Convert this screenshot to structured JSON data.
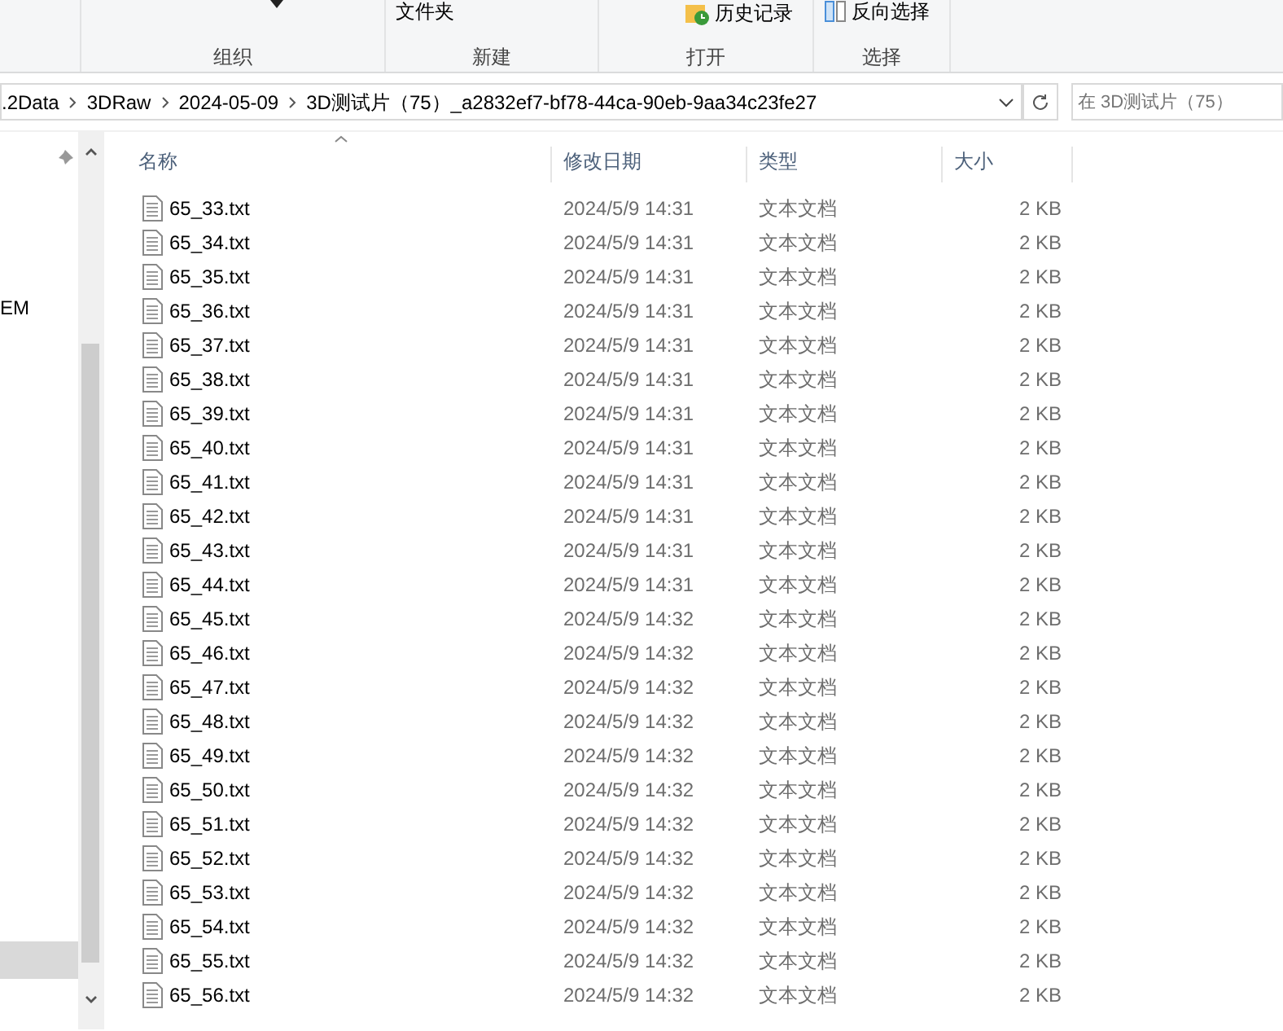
{
  "ribbon": {
    "top_items": [
      {
        "kind": "plain",
        "label": "文件夹"
      },
      {
        "kind": "history",
        "label": "历史记录"
      },
      {
        "kind": "select",
        "label": "反向选择"
      }
    ],
    "groups": [
      "组织",
      "新建",
      "打开",
      "选择"
    ]
  },
  "address_bar": {
    "crumbs": [
      ".2Data",
      "3DRaw",
      "2024-05-09",
      "3D测试片（75）_a2832ef7-bf78-44ca-90eb-9aa34c23fe27"
    ],
    "search_placeholder": "在 3D测试片（75）"
  },
  "nav_pane": {
    "items": [
      {
        "label": "EM",
        "selected": false
      },
      {
        "selected": true
      }
    ]
  },
  "file_list": {
    "columns": [
      "名称",
      "修改日期",
      "类型",
      "大小"
    ],
    "rows": [
      {
        "name": "65_33.txt",
        "date": "2024/5/9 14:31",
        "type": "文本文档",
        "size": "2 KB"
      },
      {
        "name": "65_34.txt",
        "date": "2024/5/9 14:31",
        "type": "文本文档",
        "size": "2 KB"
      },
      {
        "name": "65_35.txt",
        "date": "2024/5/9 14:31",
        "type": "文本文档",
        "size": "2 KB"
      },
      {
        "name": "65_36.txt",
        "date": "2024/5/9 14:31",
        "type": "文本文档",
        "size": "2 KB"
      },
      {
        "name": "65_37.txt",
        "date": "2024/5/9 14:31",
        "type": "文本文档",
        "size": "2 KB"
      },
      {
        "name": "65_38.txt",
        "date": "2024/5/9 14:31",
        "type": "文本文档",
        "size": "2 KB"
      },
      {
        "name": "65_39.txt",
        "date": "2024/5/9 14:31",
        "type": "文本文档",
        "size": "2 KB"
      },
      {
        "name": "65_40.txt",
        "date": "2024/5/9 14:31",
        "type": "文本文档",
        "size": "2 KB"
      },
      {
        "name": "65_41.txt",
        "date": "2024/5/9 14:31",
        "type": "文本文档",
        "size": "2 KB"
      },
      {
        "name": "65_42.txt",
        "date": "2024/5/9 14:31",
        "type": "文本文档",
        "size": "2 KB"
      },
      {
        "name": "65_43.txt",
        "date": "2024/5/9 14:31",
        "type": "文本文档",
        "size": "2 KB"
      },
      {
        "name": "65_44.txt",
        "date": "2024/5/9 14:31",
        "type": "文本文档",
        "size": "2 KB"
      },
      {
        "name": "65_45.txt",
        "date": "2024/5/9 14:32",
        "type": "文本文档",
        "size": "2 KB"
      },
      {
        "name": "65_46.txt",
        "date": "2024/5/9 14:32",
        "type": "文本文档",
        "size": "2 KB"
      },
      {
        "name": "65_47.txt",
        "date": "2024/5/9 14:32",
        "type": "文本文档",
        "size": "2 KB"
      },
      {
        "name": "65_48.txt",
        "date": "2024/5/9 14:32",
        "type": "文本文档",
        "size": "2 KB"
      },
      {
        "name": "65_49.txt",
        "date": "2024/5/9 14:32",
        "type": "文本文档",
        "size": "2 KB"
      },
      {
        "name": "65_50.txt",
        "date": "2024/5/9 14:32",
        "type": "文本文档",
        "size": "2 KB"
      },
      {
        "name": "65_51.txt",
        "date": "2024/5/9 14:32",
        "type": "文本文档",
        "size": "2 KB"
      },
      {
        "name": "65_52.txt",
        "date": "2024/5/9 14:32",
        "type": "文本文档",
        "size": "2 KB"
      },
      {
        "name": "65_53.txt",
        "date": "2024/5/9 14:32",
        "type": "文本文档",
        "size": "2 KB"
      },
      {
        "name": "65_54.txt",
        "date": "2024/5/9 14:32",
        "type": "文本文档",
        "size": "2 KB"
      },
      {
        "name": "65_55.txt",
        "date": "2024/5/9 14:32",
        "type": "文本文档",
        "size": "2 KB"
      },
      {
        "name": "65_56.txt",
        "date": "2024/5/9 14:32",
        "type": "文本文档",
        "size": "2 KB"
      }
    ]
  }
}
